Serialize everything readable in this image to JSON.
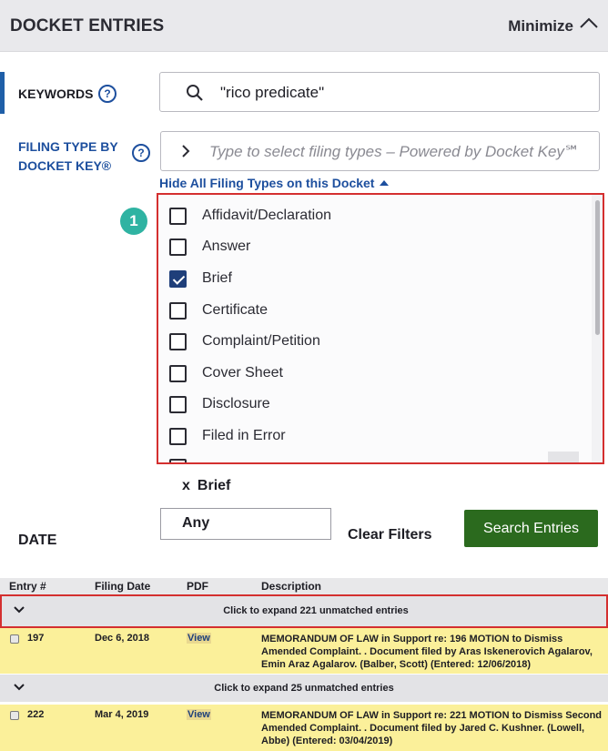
{
  "header": {
    "title": "DOCKET ENTRIES",
    "minimize_label": "Minimize"
  },
  "keywords": {
    "label": "KEYWORDS",
    "help": "?",
    "value": "\"rico predicate\""
  },
  "filing_type": {
    "label": "FILING TYPE BY DOCKET KEY®",
    "help": "?",
    "placeholder": "Type to select filing types – Powered by Docket Key℠",
    "hide_link": "Hide All Filing Types on this Docket",
    "badge": "1",
    "options": [
      {
        "label": "Affidavit/Declaration",
        "checked": false
      },
      {
        "label": "Answer",
        "checked": false
      },
      {
        "label": "Brief",
        "checked": true
      },
      {
        "label": "Certificate",
        "checked": false
      },
      {
        "label": "Complaint/Petition",
        "checked": false
      },
      {
        "label": "Cover Sheet",
        "checked": false
      },
      {
        "label": "Disclosure",
        "checked": false
      },
      {
        "label": "Filed in Error",
        "checked": false
      }
    ]
  },
  "selected_chip": {
    "x": "x",
    "label": "Brief"
  },
  "date": {
    "label": "DATE",
    "value": "Any"
  },
  "actions": {
    "clear_label": "Clear Filters",
    "search_label": "Search Entries"
  },
  "table": {
    "columns": [
      "Entry #",
      "Filing Date",
      "PDF",
      "Description"
    ],
    "expand_1": "Click to expand 221 unmatched entries",
    "expand_2": "Click to expand 25 unmatched entries",
    "rows": [
      {
        "entry": "197",
        "date": "Dec 6, 2018",
        "pdf": "View",
        "description": "MEMORANDUM OF LAW in Support re: 196 MOTION to Dismiss Amended Complaint. . Document filed by Aras Iskenerovich Agalarov, Emin Araz Agalarov. (Balber, Scott) (Entered: 12/06/2018)"
      },
      {
        "entry": "222",
        "date": "Mar 4, 2019",
        "pdf": "View",
        "description": "MEMORANDUM OF LAW in Support re: 221 MOTION to Dismiss Second Amended Complaint. . Document filed by Jared C. Kushner. (Lowell, Abbe) (Entered: 03/04/2019)"
      }
    ]
  },
  "colors": {
    "accent_blue": "#1d4f9e",
    "search_green": "#2b6a1e",
    "highlight_red": "#d42f2f",
    "row_yellow": "#fbf09a",
    "badge_teal": "#2fb3a2"
  }
}
